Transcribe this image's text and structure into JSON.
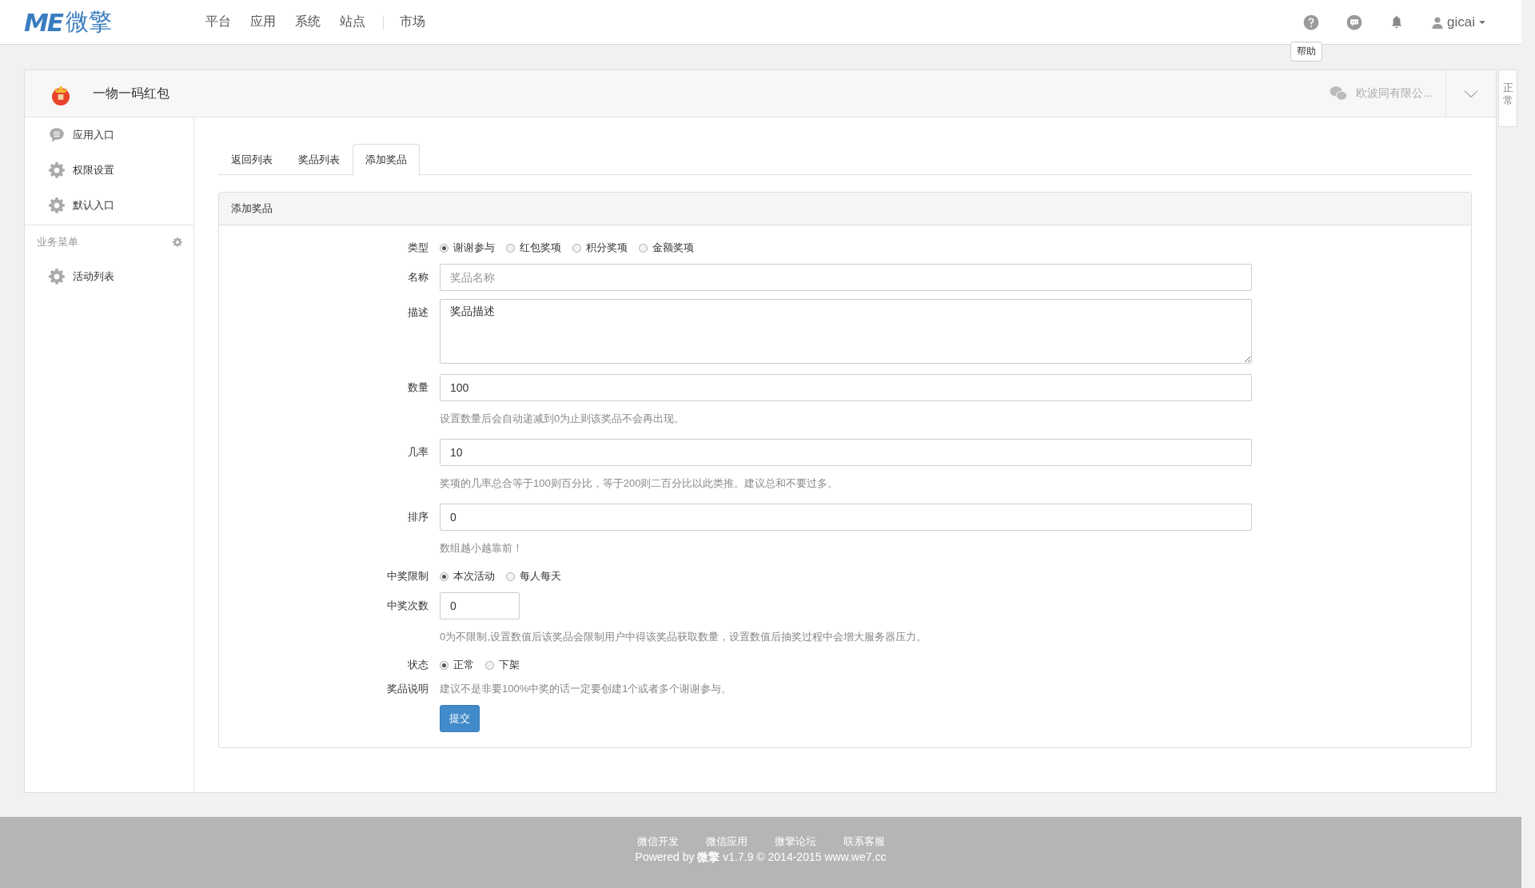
{
  "topbar": {
    "logo_mark": "ME",
    "logo_text": "微擎",
    "nav": [
      {
        "label": "平台",
        "separated": false
      },
      {
        "label": "应用",
        "separated": false
      },
      {
        "label": "系统",
        "separated": false
      },
      {
        "label": "站点",
        "separated": false
      },
      {
        "label": "市场",
        "separated": true
      }
    ],
    "user": "gicai",
    "tooltip": "帮助"
  },
  "app": {
    "title": "一物一码红包",
    "account": "欧波同有限公...",
    "side_tab": "正常"
  },
  "sidebar": {
    "items": [
      {
        "label": "应用入口",
        "kind": "chat"
      },
      {
        "label": "权限设置",
        "kind": "gear"
      },
      {
        "label": "默认入口",
        "kind": "gear"
      }
    ],
    "section": "业务菜单",
    "section_items": [
      {
        "label": "活动列表",
        "kind": "gear"
      }
    ]
  },
  "tabs": [
    {
      "label": "返回列表",
      "selected": false
    },
    {
      "label": "奖品列表",
      "selected": false
    },
    {
      "label": "添加奖品",
      "selected": true
    }
  ],
  "panel": {
    "title": "添加奖品",
    "fields": [
      {
        "kind": "radio",
        "label": "类型",
        "options": [
          {
            "label": "谢谢参与",
            "selected": true
          },
          {
            "label": "红包奖项",
            "selected": false
          },
          {
            "label": "积分奖项",
            "selected": false
          },
          {
            "label": "金额奖项",
            "selected": false
          }
        ]
      },
      {
        "kind": "input",
        "label": "名称",
        "placeholder": "奖品名称"
      },
      {
        "kind": "textarea",
        "label": "描述",
        "value": "奖品描述"
      },
      {
        "kind": "input",
        "label": "数量",
        "value": "100",
        "help": "设置数量后会自动递减到0为止则该奖品不会再出现。"
      },
      {
        "kind": "input",
        "label": "几率",
        "value": "10",
        "help": "奖项的几率总合等于100则百分比，等于200则二百分比以此类推。建议总和不要过多。"
      },
      {
        "kind": "input",
        "label": "排序",
        "value": "0",
        "help": "数组越小越靠前！"
      },
      {
        "kind": "radio",
        "label": "中奖限制",
        "options": [
          {
            "label": "本次活动",
            "selected": true
          },
          {
            "label": "每人每天",
            "selected": false
          }
        ]
      },
      {
        "kind": "short-input",
        "label": "中奖次数",
        "value": "0",
        "help": "0为不限制,设置数值后该奖品会限制用户中得该奖品获取数量，设置数值后抽奖过程中会增大服务器压力。"
      },
      {
        "kind": "radio",
        "label": "状态",
        "options": [
          {
            "label": "正常",
            "selected": true
          },
          {
            "label": "下架",
            "selected": false
          }
        ]
      },
      {
        "kind": "note",
        "label": "奖品说明",
        "text": "建议不是非要100%中奖的话一定要创建1个或者多个谢谢参与。"
      }
    ],
    "submit": "提交"
  },
  "footer": {
    "links": [
      "微信开发",
      "微信应用",
      "微擎论坛",
      "联系客服"
    ],
    "powered": "Powered by **微擎** v1.7.9 © 2014-2015 www.we7.cc"
  }
}
